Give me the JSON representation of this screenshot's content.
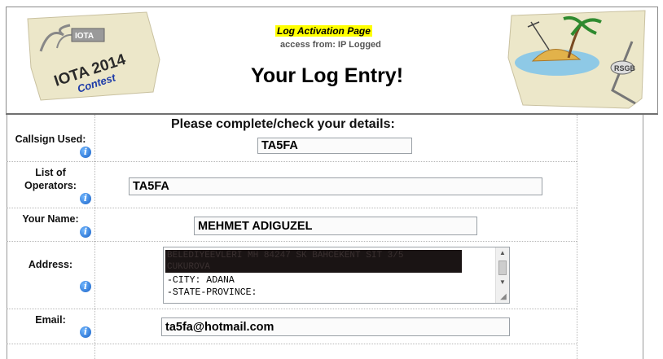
{
  "header": {
    "activation_link": "Log Activation Page",
    "access_text": "access from: IP Logged",
    "title": "Your Log Entry!",
    "left_logo": {
      "line1": "IOTA",
      "line2": "IOTA 2014",
      "line3": "Contest"
    },
    "right_logo": {
      "badge": "RSGB"
    }
  },
  "form": {
    "heading": "Please complete/check your details:",
    "callsign": {
      "label": "Callsign Used:",
      "value": "TA5FA"
    },
    "operators": {
      "label_line1": "List of",
      "label_line2": "Operators:",
      "value": "TA5FA"
    },
    "name": {
      "label": "Your Name:",
      "value": "MEHMET ADIGUZEL"
    },
    "address": {
      "label": "Address:",
      "redacted_line1": "BELEDIYEEVLERI MH 84247 SK BAHCEKENT SIT 3/5",
      "redacted_line2": "CUKUROVA",
      "line3": "-CITY: ADANA",
      "line4": "-STATE-PROVINCE:"
    },
    "email": {
      "label": "Email:",
      "value": "ta5fa@hotmail.com"
    },
    "info_glyph": "i"
  },
  "colors": {
    "highlight": "#ffff00",
    "info_icon": "#1a62c6"
  }
}
